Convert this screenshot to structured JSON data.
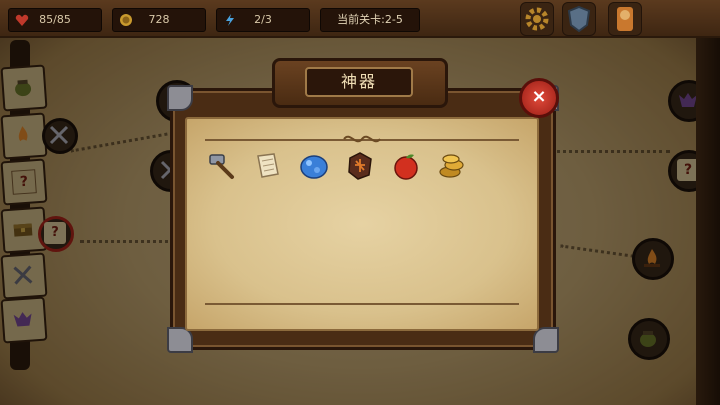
{
  "hud": {
    "health": "85/85",
    "gold": "728",
    "energy": "2/3",
    "stage": "当前关卡:2-5"
  },
  "hud_icons": [
    "heart-icon",
    "coin-icon",
    "lightning-icon",
    "settings-gear-icon",
    "shield-emblem-icon",
    "character-portrait-icon"
  ],
  "sidebar": {
    "cards": [
      "green-pot-icon",
      "campfire-icon",
      "question-mark-icon",
      "treasure-chest-icon",
      "crossed-swords-icon",
      "demon-mask-icon"
    ],
    "question_label": "?"
  },
  "dialog": {
    "title": "神器",
    "close_label": "×",
    "artifacts": [
      {
        "name": "hammer"
      },
      {
        "name": "scroll"
      },
      {
        "name": "blue-gem"
      },
      {
        "name": "rune-stone"
      },
      {
        "name": "red-apple"
      },
      {
        "name": "gold-coins"
      }
    ]
  },
  "colors": {
    "accent_red": "#c23a2c",
    "parchment": "#dcc48f",
    "wood_dark": "#3e2612"
  }
}
